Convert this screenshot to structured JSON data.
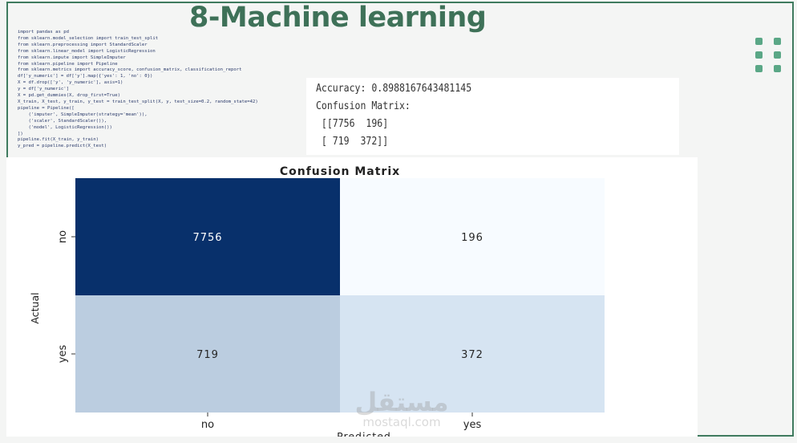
{
  "slide": {
    "title": "8-Machine learning"
  },
  "code": {
    "lines": [
      "import pandas as pd",
      "from sklearn.model_selection import train_test_split",
      "from sklearn.preprocessing import StandardScaler",
      "from sklearn.linear_model import LogisticRegression",
      "from sklearn.impute import SimpleImputer",
      "from sklearn.pipeline import Pipeline",
      "from sklearn.metrics import accuracy_score, confusion_matrix, classification_report",
      "df['y_numeric'] = df['y'].map({'yes': 1, 'no': 0})",
      "X = df.drop(['y', 'y_numeric'], axis=1)",
      "y = df['y_numeric']",
      "X = pd.get_dummies(X, drop_first=True)",
      "X_train, X_test, y_train, y_test = train_test_split(X, y, test_size=0.2, random_state=42)",
      "pipeline = Pipeline([",
      "    ('imputer', SimpleImputer(strategy='mean')),",
      "    ('scaler', StandardScaler()),",
      "    ('model', LogisticRegression())",
      "])",
      "pipeline.fit(X_train, y_train)",
      "y_pred = pipeline.predict(X_test)"
    ]
  },
  "output": {
    "accuracy_line": "Accuracy: 0.8988167643481145",
    "cm_label": "Confusion Matrix:",
    "cm_row1": " [[7756  196]",
    "cm_row2": " [ 719  372]]"
  },
  "chart_data": {
    "type": "heatmap",
    "title": "Confusion Matrix",
    "xlabel": "Predicted",
    "ylabel": "Actual",
    "x_categories": [
      "no",
      "yes"
    ],
    "y_categories": [
      "no",
      "yes"
    ],
    "values": [
      [
        7756,
        196
      ],
      [
        719,
        372
      ]
    ],
    "colormap": "Blues",
    "colors": {
      "high": "#08306b",
      "mid_text_dark": "#262626",
      "text_light": "#ffffff"
    }
  },
  "watermark": {
    "arabic": "مستقل",
    "latin": "mostaql.com"
  },
  "colors": {
    "accent": "#3e7158",
    "frame": "#3f7b5f",
    "dots": "#5aa786"
  },
  "icons": {
    "decoration": "dot-grid-icon"
  }
}
